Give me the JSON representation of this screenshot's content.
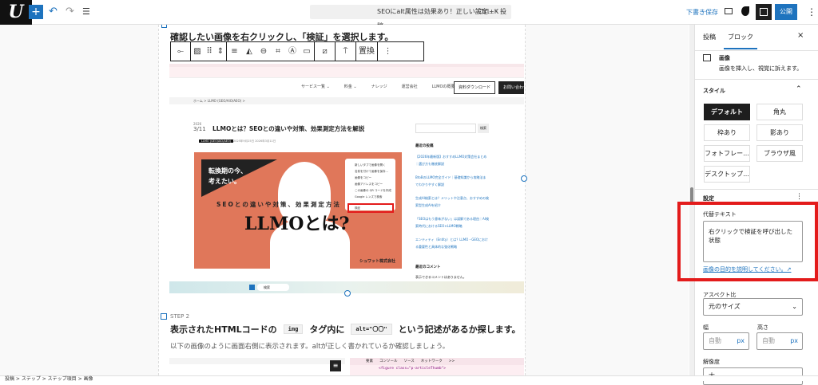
{
  "topbar": {
    "logo": "U",
    "add": "+",
    "undo": "↶",
    "redo": "↷",
    "list": "☰",
    "command": "SEOにalt属性は効果あり！正しい設定...  · 投稿",
    "shortcut": "Ctrl+K",
    "save_draft": "下書き保存",
    "publish": "公開",
    "more": "⋮"
  },
  "editor": {
    "step1_heading": "確認したい画像を右クリックし、「検証」を選択します。",
    "toolbar": {
      "replace": "置換",
      "more": "⋮"
    },
    "screenshot": {
      "nav": [
        "サービス一覧 ⌄",
        "料金 ⌄",
        "ナレッジ",
        "運営会社",
        "LLMOの概要"
      ],
      "download": "資料ダウンロード",
      "contact": "お問い合わせ",
      "breadcrumb": "ホーム > LLMO (GEO/AIO/AEO) >",
      "date_year": "2026",
      "date_day": "3/11",
      "post_title": "LLMOとは？SEOとの違いや対策、効果測定方法を解説",
      "category": "LLMO (GEO/AIO/AEO)",
      "dates": "2025年9月25日 2026年3月11日",
      "banner_line1": "転換期の今、",
      "banner_line2": "考えたい。",
      "banner_sub": "SEOとの違いや対策、効果測定方法",
      "banner_title": "LLMOとは?",
      "banner_company": "シュワット株式会社",
      "context_menu": [
        "新しいタブで画像を開く",
        "名前を付けて画像を保存...",
        "画像をコピー",
        "画像アドレスをコピー",
        "この画像の QR コードを作成",
        "Google レンズで検索",
        "検証"
      ],
      "search_button": "検索",
      "recent_posts_title": "最近の投稿",
      "recent_posts": [
        "【2026年最新版】おすすめLLMO対策会社まとめ｜選び方も徹底解説",
        "BtoBのLLMO完全ガイド｜基礎知識から攻略法までわかりやすく解説",
        "生成AI検索とは？メリットや注意点、おすすめの検索型生成AIを紹介",
        "「SEOはもう意味がない」は誤解である理由｜AI検索時代におけるSEO×LLMO戦略",
        "エンティティ（Entity）とは？LLMO・GEOにおける重要性と具体的な強化戦略"
      ],
      "recent_comments_title": "最近のコメント",
      "no_comments": "表示できるコメントはありません。",
      "taskbar_search": "検索"
    },
    "step2_label": "STEP 2",
    "step2_heading_pre": "表示されたHTMLコードの",
    "step2_code1": "img",
    "step2_heading_mid": "タグ内に",
    "step2_code2": "alt=\"〇〇\"",
    "step2_heading_post": "という記述があるか探します。",
    "step2_body": "以下の画像のように画面右側に表示されます。altが正しく書かれているか確認しましょう。",
    "devtools_tabs": [
      "要素",
      "コンソール",
      "ソース",
      "ネットワーク",
      ">>"
    ],
    "devtools_code": "<figure class=\"p-articleThumb\">"
  },
  "sidebar": {
    "tabs": [
      "投稿",
      "ブロック"
    ],
    "close": "×",
    "block_name": "画像",
    "block_desc": "画像を挿入し、視覚に訴えます。",
    "styles_title": "スタイル",
    "styles": [
      "デフォルト",
      "角丸",
      "枠あり",
      "影あり",
      "フォトフレー...",
      "ブラウザ風",
      "デスクトップ..."
    ],
    "settings_title": "設定",
    "alt_label": "代替テキスト",
    "alt_value": "右クリックで検証を呼び出した状態",
    "alt_help": "画像の目的を説明してください。↗",
    "aspect_label": "アスペクト比",
    "aspect_value": "元のサイズ",
    "width_label": "幅",
    "height_label": "高さ",
    "auto": "自動",
    "px": "px",
    "resolution_label": "解像度",
    "resolution_value": "大"
  },
  "statusbar": {
    "breadcrumb": "投稿 > ステップ > ステップ項目 > 画像"
  },
  "colors": {
    "accent": "#1e73be",
    "highlight": "#e31b1b",
    "banner": "#e0775a"
  }
}
